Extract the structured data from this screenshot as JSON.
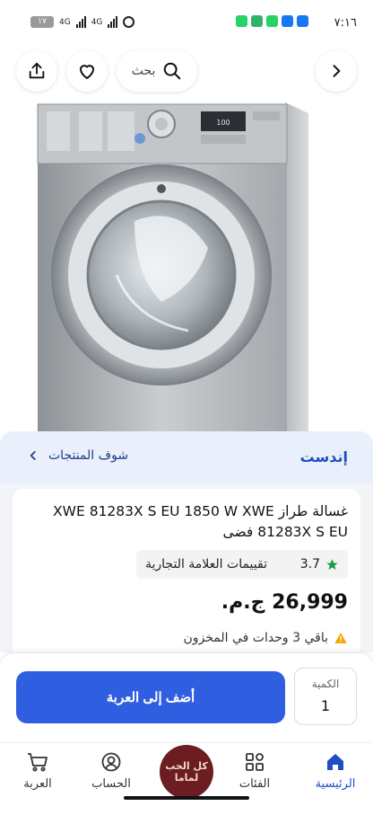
{
  "status_bar": {
    "time": "٧:١٦",
    "battery": "١٧",
    "network_1": "4G",
    "network_2": "4G",
    "app_colors": [
      "#25d366",
      "#2fb36b",
      "#25d366",
      "#1877f2",
      "#1877f2"
    ]
  },
  "top_nav": {
    "search_label": "بحث",
    "icons": [
      "share-icon",
      "heart-icon",
      "search-icon",
      "chevron-right-icon"
    ]
  },
  "brand": {
    "name": "إندست",
    "see_products": "شوف المنتجات"
  },
  "product": {
    "title": "غسالة طراز XWE 81283X S EU 1850 W XWE 81283X S EU فضى",
    "rating_score": "3.7",
    "rating_label": "تقييمات العلامة التجارية",
    "price": "26,999 ج.م.",
    "stock": "باقي 3 وحدات في المخزون",
    "panel_display": "100"
  },
  "cart": {
    "add_label": "أضف إلى العربة",
    "qty_label": "الكمية",
    "qty_value": "1"
  },
  "bottom_nav": {
    "home": "الرئيسية",
    "categories": "الفئات",
    "promo_line1": "كل الحب",
    "promo_line2": "لماما",
    "account": "الحساب",
    "cart": "العربة"
  },
  "colors": {
    "accent": "#2f5fe0",
    "brand": "#1f4fc4",
    "brand_bar_bg": "#e9f0fc",
    "star": "#1e9b46",
    "promo_bg": "#6b1d21"
  }
}
